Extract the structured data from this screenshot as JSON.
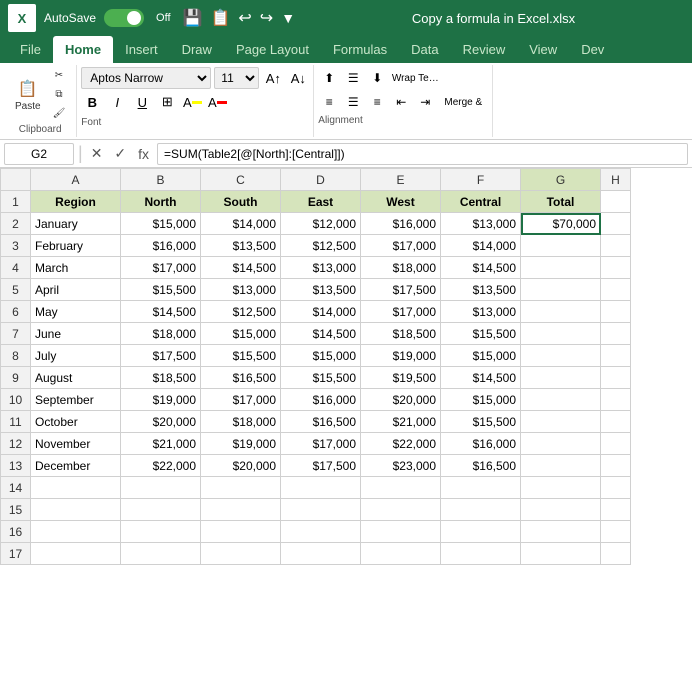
{
  "titleBar": {
    "logo": "X",
    "autosaveLabel": "AutoSave",
    "autosaveState": "Off",
    "fileName": "Copy a formula in Excel.xlsx",
    "icons": [
      "save",
      "save-as",
      "undo",
      "redo",
      "more"
    ]
  },
  "ribbonTabs": [
    "File",
    "Home",
    "Insert",
    "Draw",
    "Page Layout",
    "Formulas",
    "Data",
    "Review",
    "View",
    "Dev"
  ],
  "activeTab": "Home",
  "ribbon": {
    "clipboard": {
      "label": "Clipboard",
      "buttons": [
        "Paste",
        "Cut",
        "Copy",
        "Format Painter"
      ]
    },
    "font": {
      "label": "Font",
      "fontName": "Aptos Narrow",
      "fontSize": "11",
      "bold": "B",
      "italic": "I",
      "underline": "U"
    },
    "alignment": {
      "label": "Alignment"
    },
    "wrapText": "Wrap Text",
    "mergeCenter": "Merge &"
  },
  "formulaBar": {
    "cellRef": "G2",
    "formula": "=SUM(Table2[@[North]:[Central]])"
  },
  "columns": {
    "headers": [
      "",
      "A",
      "B",
      "C",
      "D",
      "E",
      "F",
      "G",
      "H"
    ],
    "widths": [
      30,
      90,
      80,
      80,
      80,
      80,
      80,
      80,
      30
    ]
  },
  "tableHeaders": {
    "row": 1,
    "cols": [
      "Region",
      "North",
      "South",
      "East",
      "West",
      "Central",
      "Total"
    ]
  },
  "rows": [
    {
      "rowNum": 2,
      "region": "January",
      "north": "$15,000",
      "south": "$14,000",
      "east": "$12,000",
      "west": "$16,000",
      "central": "$13,000",
      "total": "$70,000"
    },
    {
      "rowNum": 3,
      "region": "February",
      "north": "$16,000",
      "south": "$13,500",
      "east": "$12,500",
      "west": "$17,000",
      "central": "$14,000",
      "total": ""
    },
    {
      "rowNum": 4,
      "region": "March",
      "north": "$17,000",
      "south": "$14,500",
      "east": "$13,000",
      "west": "$18,000",
      "central": "$14,500",
      "total": ""
    },
    {
      "rowNum": 5,
      "region": "April",
      "north": "$15,500",
      "south": "$13,000",
      "east": "$13,500",
      "west": "$17,500",
      "central": "$13,500",
      "total": ""
    },
    {
      "rowNum": 6,
      "region": "May",
      "north": "$14,500",
      "south": "$12,500",
      "east": "$14,000",
      "west": "$17,000",
      "central": "$13,000",
      "total": ""
    },
    {
      "rowNum": 7,
      "region": "June",
      "north": "$18,000",
      "south": "$15,000",
      "east": "$14,500",
      "west": "$18,500",
      "central": "$15,500",
      "total": ""
    },
    {
      "rowNum": 8,
      "region": "July",
      "north": "$17,500",
      "south": "$15,500",
      "east": "$15,000",
      "west": "$19,000",
      "central": "$15,000",
      "total": ""
    },
    {
      "rowNum": 9,
      "region": "August",
      "north": "$18,500",
      "south": "$16,500",
      "east": "$15,500",
      "west": "$19,500",
      "central": "$14,500",
      "total": ""
    },
    {
      "rowNum": 10,
      "region": "September",
      "north": "$19,000",
      "south": "$17,000",
      "east": "$16,000",
      "west": "$20,000",
      "central": "$15,000",
      "total": ""
    },
    {
      "rowNum": 11,
      "region": "October",
      "north": "$20,000",
      "south": "$18,000",
      "east": "$16,500",
      "west": "$21,000",
      "central": "$15,500",
      "total": ""
    },
    {
      "rowNum": 12,
      "region": "November",
      "north": "$21,000",
      "south": "$19,000",
      "east": "$17,000",
      "west": "$22,000",
      "central": "$16,000",
      "total": ""
    },
    {
      "rowNum": 13,
      "region": "December",
      "north": "$22,000",
      "south": "$20,000",
      "east": "$17,500",
      "west": "$23,000",
      "central": "$16,500",
      "total": ""
    }
  ],
  "extraRows": [
    14,
    15,
    16,
    17
  ]
}
